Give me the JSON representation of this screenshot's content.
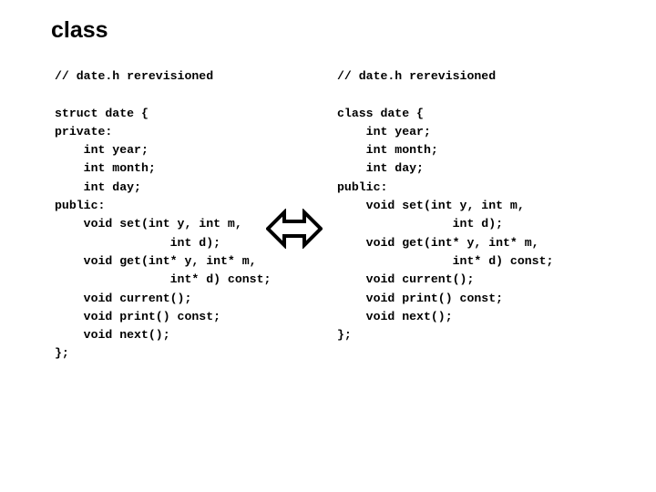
{
  "slide": {
    "title": "class",
    "background_color": "#ffffff",
    "text_color": "#000000"
  },
  "left_code": {
    "name": "original-struct-version",
    "lines": [
      "// date.h rerevisioned",
      "",
      "struct date {",
      "private:",
      "    int year;",
      "    int month;",
      "    int day;",
      "public:",
      "    void set(int y, int m,",
      "                int d);",
      "    void get(int* y, int* m,",
      "                int* d) const;",
      "    void current();",
      "    void print() const;",
      "    void next();",
      "};"
    ]
  },
  "right_code": {
    "name": "revised-class-version",
    "lines": [
      "// date.h rerevisioned",
      "",
      "class date {",
      "    int year;",
      "    int month;",
      "    int day;",
      "public:",
      "    void set(int y, int m,",
      "                int d);",
      "    void get(int* y, int* m,",
      "                int* d) const;",
      "    void current();",
      "    void print() const;",
      "    void next();",
      "};"
    ]
  },
  "arrow": {
    "icon": "double-headed-arrow-icon",
    "direction": "horizontal-bidirectional",
    "fill_color": "#ffffff",
    "stroke_color": "#000000"
  }
}
